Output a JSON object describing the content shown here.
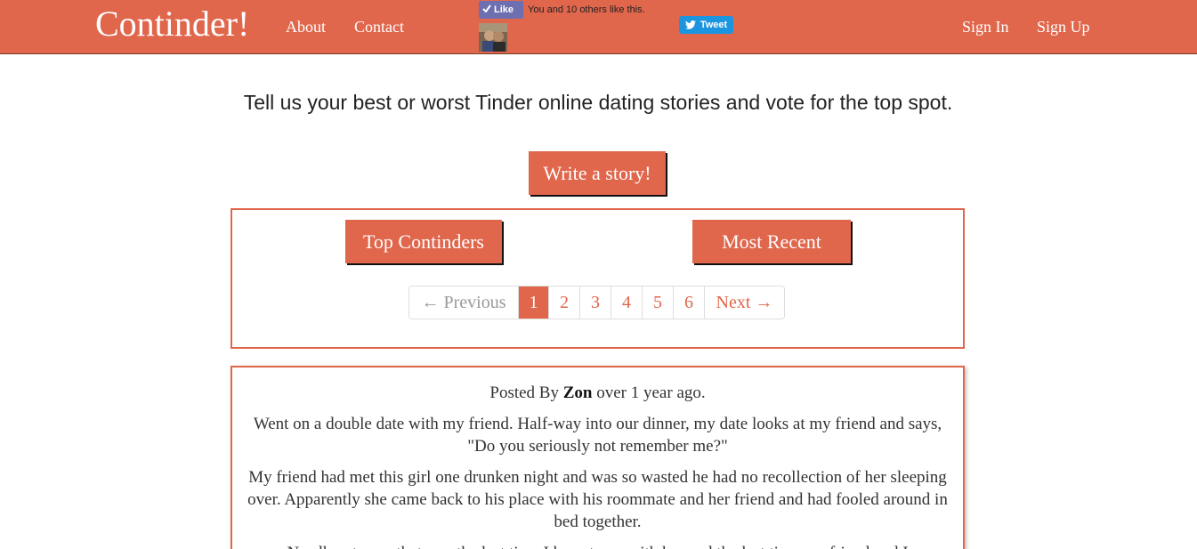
{
  "navbar": {
    "brand": "Continder!",
    "links": {
      "about": "About",
      "contact": "Contact",
      "sign_in": "Sign In",
      "sign_up": "Sign Up"
    },
    "facebook": {
      "like_label": "Like",
      "social_text": "You and 10 others like this."
    },
    "twitter": {
      "tweet_label": "Tweet"
    },
    "brand_color": "#e0664c"
  },
  "hero": {
    "tagline": "Tell us your best or worst Tinder online dating stories and vote for the top spot.",
    "cta_label": "Write a story!"
  },
  "filters": {
    "top_label": "Top Continders",
    "recent_label": "Most Recent"
  },
  "pagination": {
    "previous_label": "← Previous",
    "next_label": "Next →",
    "pages": [
      "1",
      "2",
      "3",
      "4",
      "5",
      "6"
    ],
    "current_page": "1"
  },
  "story": {
    "posted_prefix": "Posted By",
    "author": "Zon",
    "posted_suffix": "over 1 year ago.",
    "paragraphs": [
      "Went on a double date with my friend. Half-way into our dinner, my date looks at my friend and says, \"Do you seriously not remember me?\"",
      "My friend had met this girl one drunken night and was so wasted he had no recollection of her sleeping over. Apparently she came back to his place with his roommate and her friend and had fooled around in bed together.",
      "Needless to say that was the last time I have to go with her and the last time my friend and I"
    ]
  }
}
